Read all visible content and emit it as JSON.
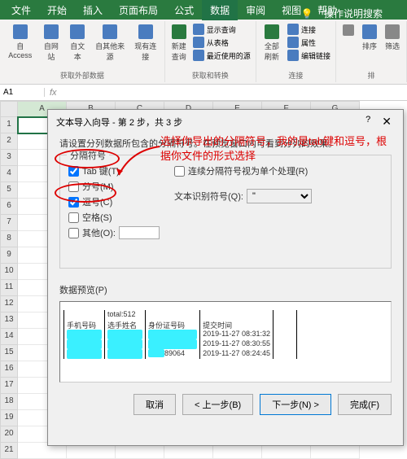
{
  "menubar": {
    "items": [
      "文件",
      "开始",
      "插入",
      "页面布局",
      "公式",
      "数据",
      "审阅",
      "视图",
      "帮助"
    ],
    "help": "操作说明搜索"
  },
  "ribbon": {
    "ext": {
      "items": [
        "自 Access",
        "自网站",
        "自文本",
        "自其他来源",
        "现有连接"
      ],
      "label": "获取外部数据"
    },
    "query": {
      "big": "新建\n查询",
      "items": [
        "显示查询",
        "从表格",
        "最近使用的源"
      ],
      "label": "获取和转换"
    },
    "conn": {
      "big": "全部刷新",
      "items": [
        "连接",
        "属性",
        "编辑链接"
      ],
      "label": "连接"
    },
    "sort": {
      "items": [
        "排序",
        "筛选"
      ],
      "label": "排"
    }
  },
  "namebox": "A1",
  "colhdrs": [
    "A",
    "B",
    "C",
    "D",
    "E",
    "F",
    "G"
  ],
  "rows": [
    "1",
    "2",
    "3",
    "4",
    "5",
    "6",
    "7",
    "8",
    "9",
    "10",
    "11",
    "12",
    "13",
    "14",
    "15",
    "16",
    "17",
    "18",
    "19",
    "20",
    "21"
  ],
  "dialog": {
    "title": "文本导入向导 - 第 2 步，共 3 步",
    "desc": "请设置分列数据所包含的分隔符号。在预览窗口内可看到分列的效果。",
    "fs_legend": "分隔符号",
    "delims": {
      "tab": "Tab 键(T)",
      "semi": "分号(M)",
      "comma": "逗号(C)",
      "space": "空格(S)",
      "other": "其他(O):"
    },
    "consec": "连续分隔符号视为单个处理(R)",
    "qual_label": "文本识别符号(Q):",
    "qual_value": "\"",
    "preview_label": "数据预览(P)",
    "annotation": "选择你导出的分隔符号，我的是tab键和逗号，根据你文件的形式选择",
    "preview": {
      "c1": {
        "h": "手机号码"
      },
      "c2": {
        "h": "total:512",
        "h2": "选手姓名"
      },
      "c3": {
        "h": "身份证号码",
        "tail": "89064"
      },
      "c4": {
        "h": "提交时间",
        "r1": "2019-11-27 08:31:32",
        "r2": "2019-11-27 08:30:55",
        "r3": "2019-11-27 08:24:45"
      }
    },
    "buttons": {
      "cancel": "取消",
      "back": "< 上一步(B)",
      "next": "下一步(N) >",
      "finish": "完成(F)"
    }
  }
}
